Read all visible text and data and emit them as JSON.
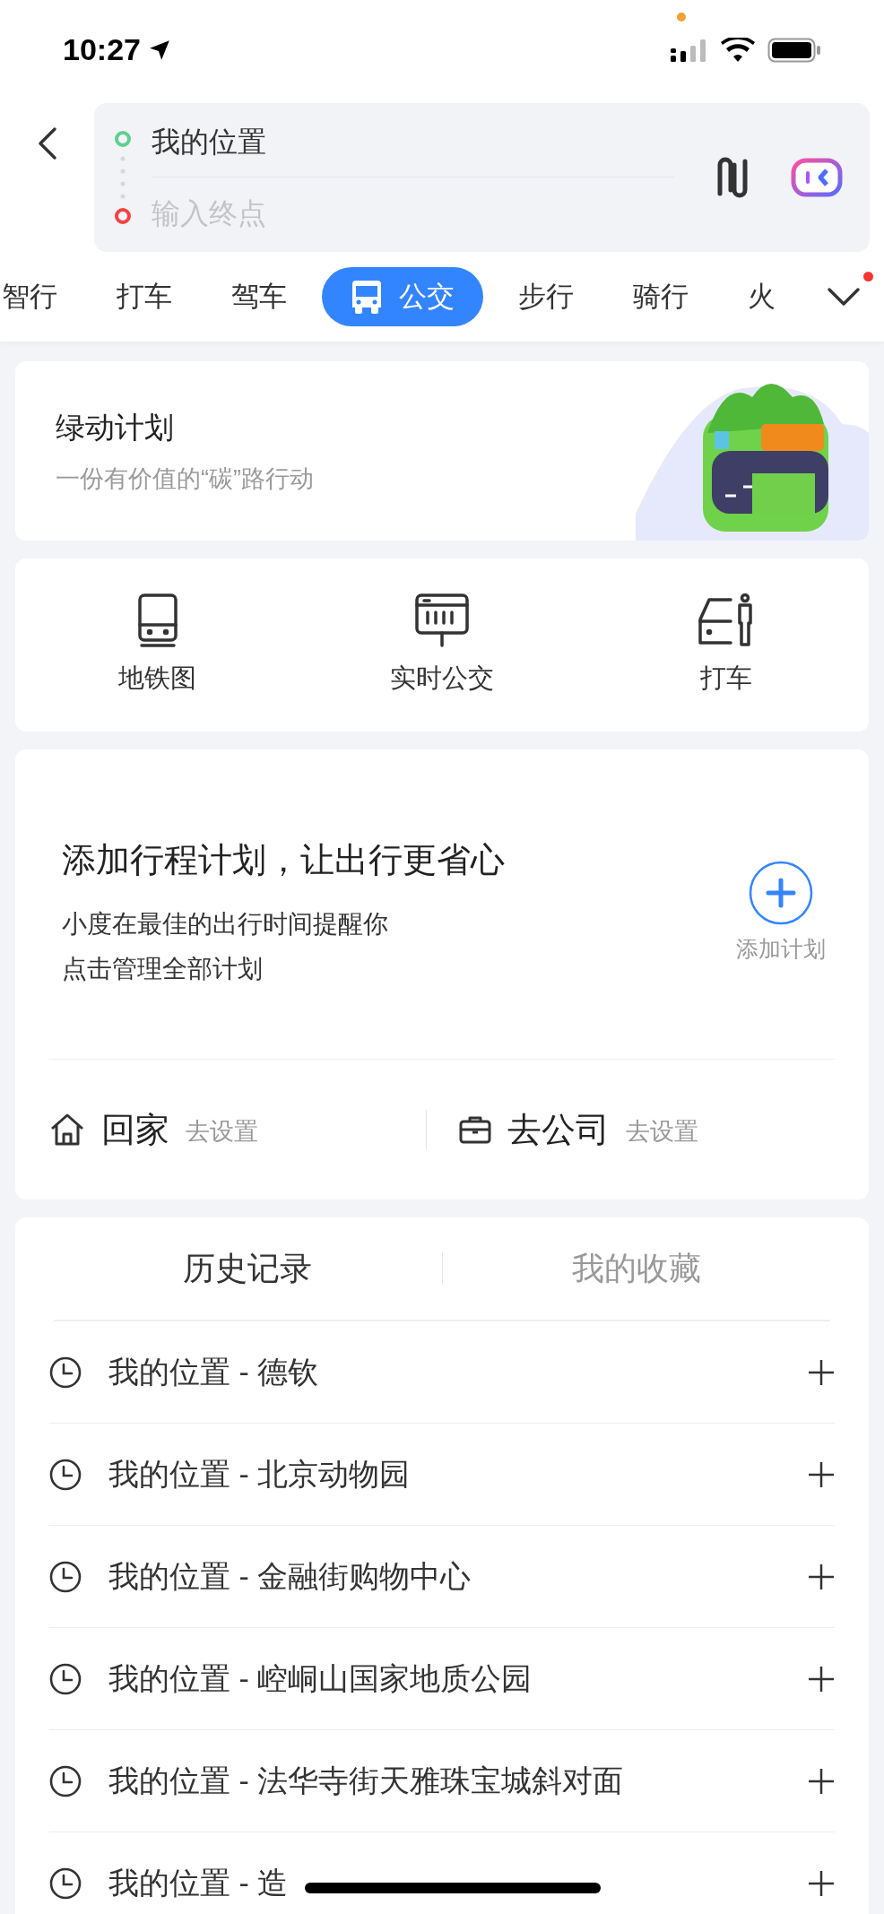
{
  "status_bar": {
    "time": "10:27"
  },
  "route": {
    "origin": "我的位置",
    "destination_placeholder": "输入终点"
  },
  "modes": [
    {
      "label": "智行",
      "selected": false
    },
    {
      "label": "打车",
      "selected": false
    },
    {
      "label": "驾车",
      "selected": false
    },
    {
      "label": "公交",
      "selected": true
    },
    {
      "label": "步行",
      "selected": false
    },
    {
      "label": "骑行",
      "selected": false
    },
    {
      "label": "火",
      "selected": false
    }
  ],
  "modes_more": {
    "has_notification": true
  },
  "banner": {
    "title": "绿动计划",
    "subtitle": "一份有价值的“碳”路行动",
    "kind": "picture"
  },
  "shortcuts": [
    {
      "label": "地铁图",
      "kind": "subway"
    },
    {
      "label": "实时公交",
      "kind": "bus_stop"
    },
    {
      "label": "打车",
      "kind": "taxi"
    }
  ],
  "plan": {
    "title": "添加行程计划，让出行更省心",
    "lines": [
      "小度在最佳的出行时间提醒你",
      "点击管理全部计划"
    ],
    "add_label": "添加计划"
  },
  "commute": [
    {
      "kind": "home",
      "label": "回家",
      "action": "去设置"
    },
    {
      "kind": "work",
      "label": "去公司",
      "action": "去设置"
    }
  ],
  "list_tabs": [
    {
      "label": "历史记录",
      "selected": true
    },
    {
      "label": "我的收藏",
      "selected": false
    }
  ],
  "history": [
    "我的位置 - 德钦",
    "我的位置 - 北京动物园",
    "我的位置 - 金融街购物中心",
    "我的位置 - 崆峒山国家地质公园",
    "我的位置 - 法华寺街天雅珠宝城斜对面",
    "我的位置 - 造"
  ]
}
